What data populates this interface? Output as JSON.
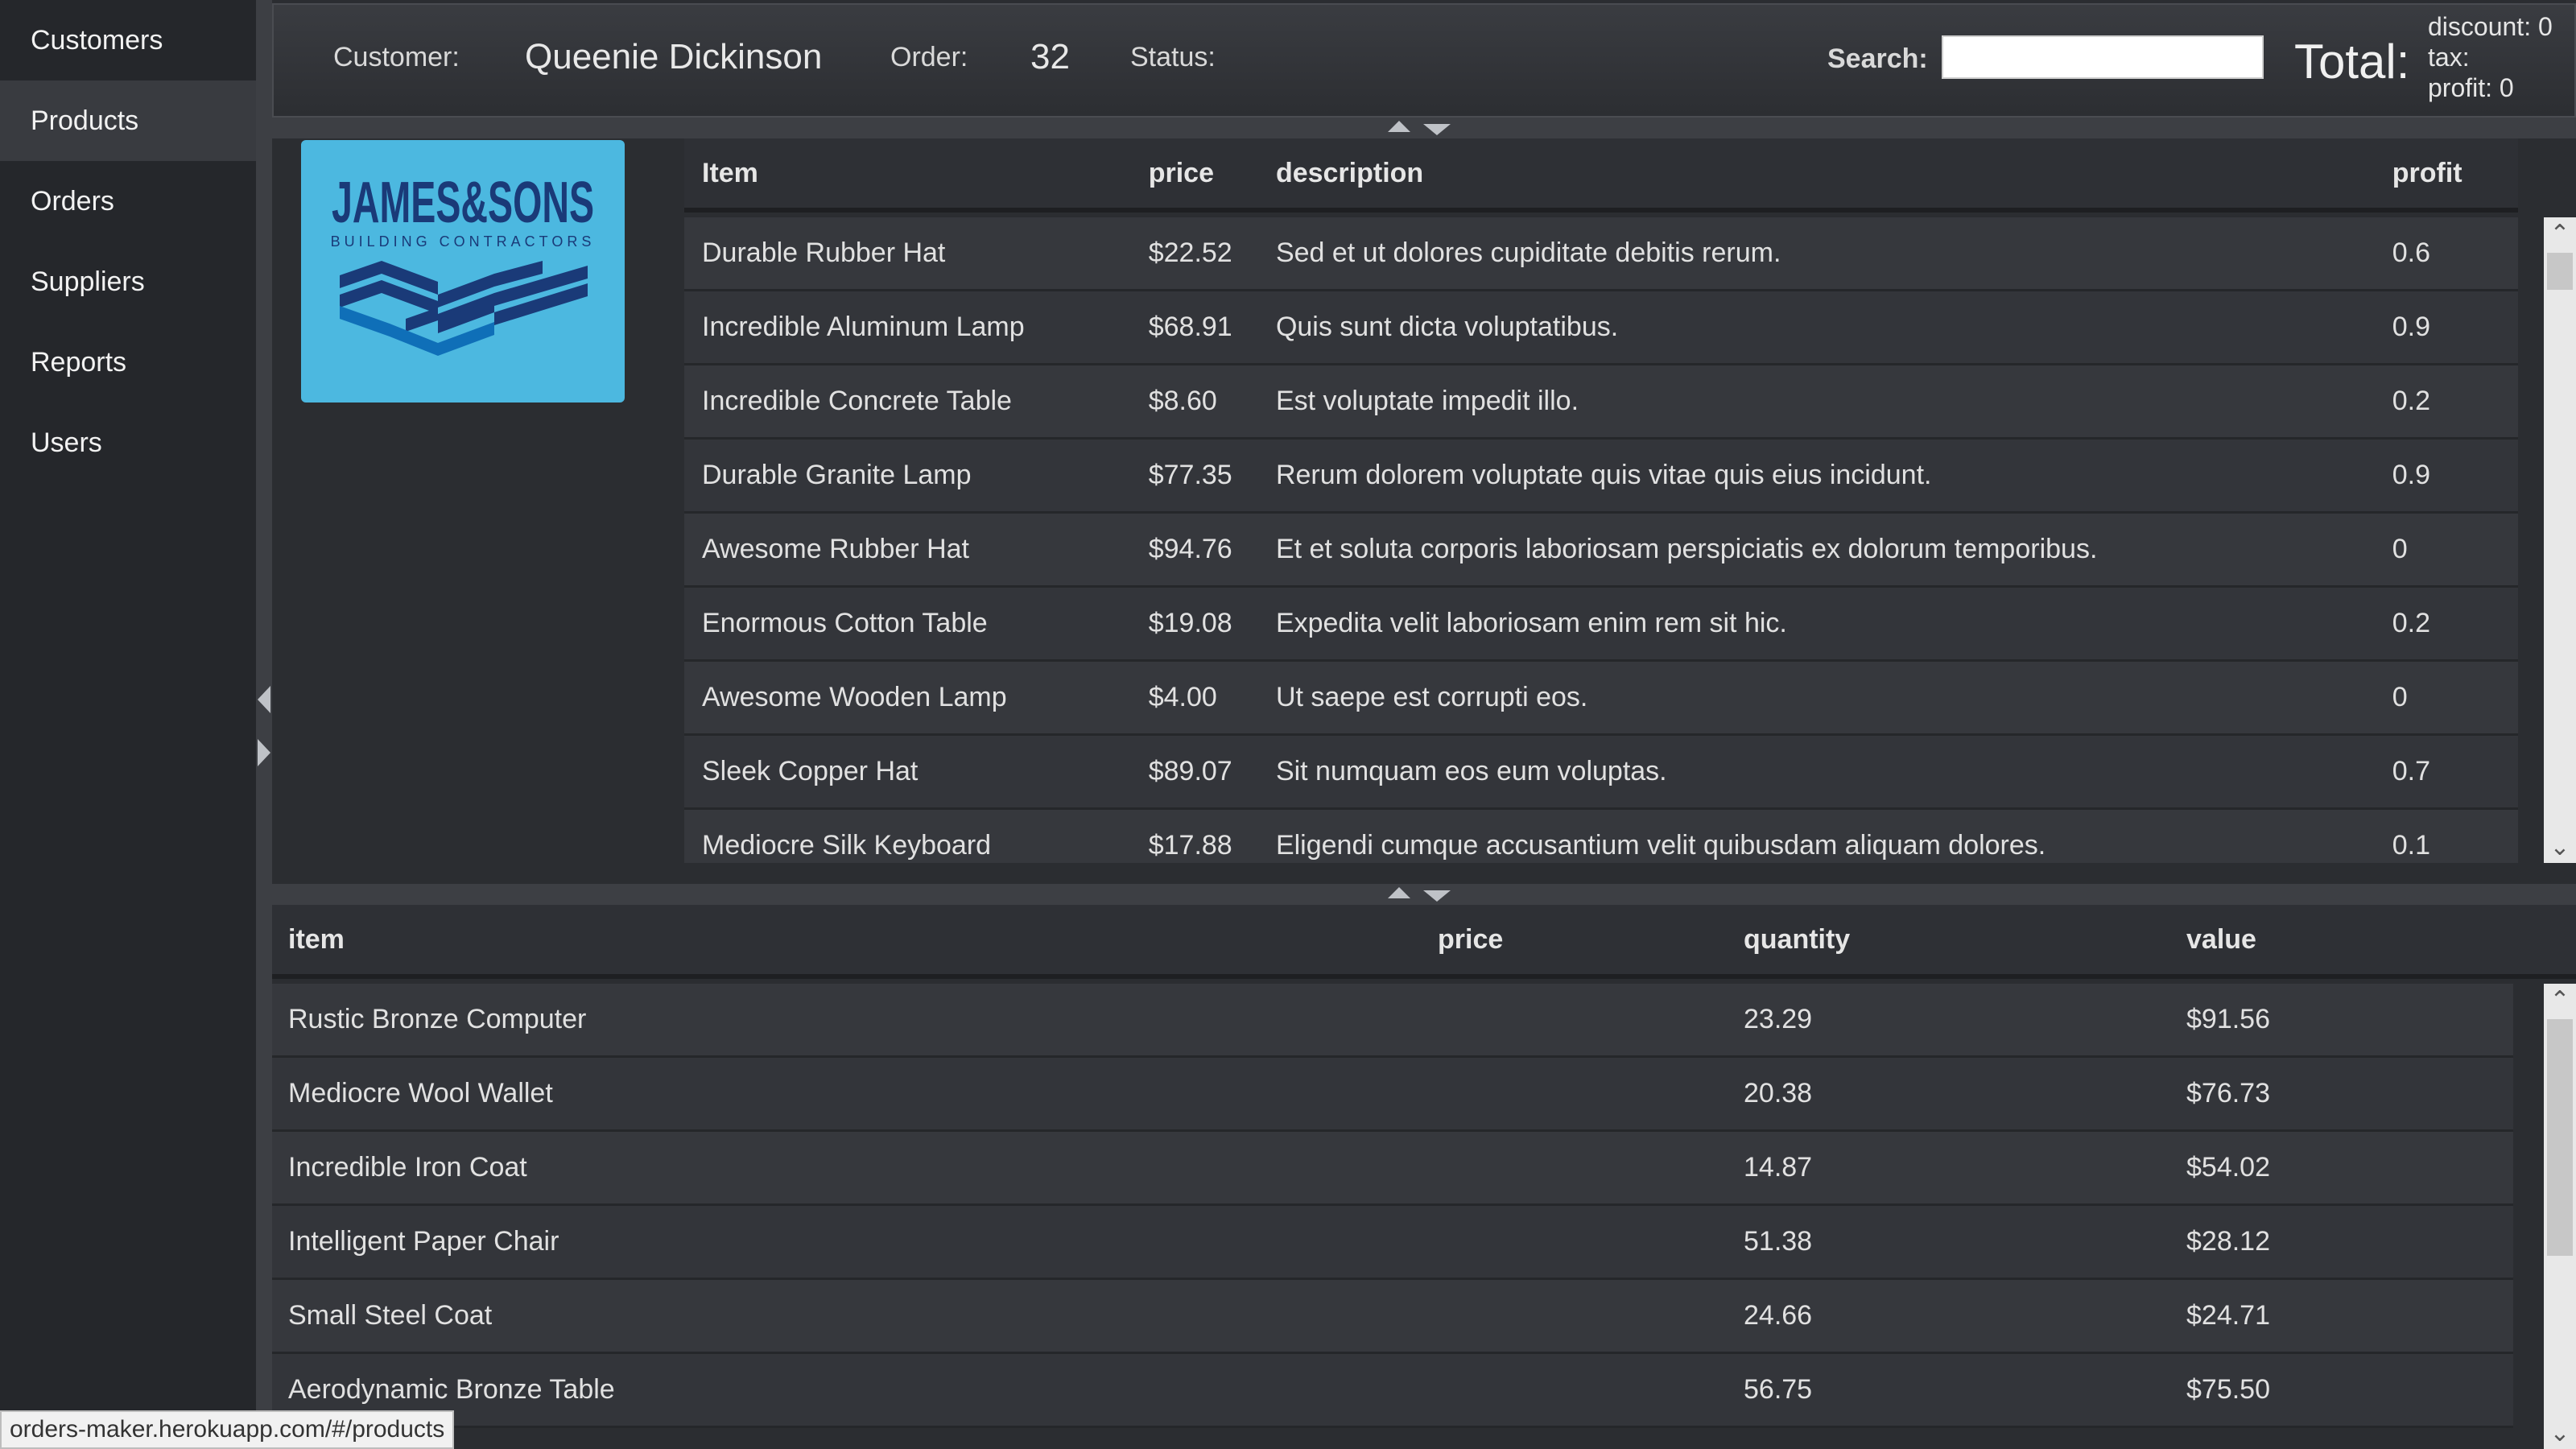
{
  "sidebar": {
    "items": [
      {
        "label": "Customers"
      },
      {
        "label": "Products"
      },
      {
        "label": "Orders"
      },
      {
        "label": "Suppliers"
      },
      {
        "label": "Reports"
      },
      {
        "label": "Users"
      }
    ],
    "active_index": 1
  },
  "header": {
    "customer_label": "Customer:",
    "customer_name": "Queenie Dickinson",
    "order_label": "Order:",
    "order_number": "32",
    "status_label": "Status:",
    "search_label": "Search:",
    "search_value": "",
    "total_label": "Total:",
    "discount_text": "discount: 0",
    "tax_text": "tax:",
    "profit_text": "profit: 0"
  },
  "logo": {
    "brand": "JAMES&SONS",
    "brand_main": "JAMES",
    "brand_amp": "&",
    "brand_end": "SONS",
    "tagline": "BUILDING CONTRACTORS",
    "bg_color": "#4cb8e0",
    "dark_color": "#1a3a78"
  },
  "products": {
    "columns": {
      "item": "Item",
      "price": "price",
      "description": "description",
      "profit": "profit"
    },
    "rows": [
      {
        "item": "Durable Rubber Hat",
        "price": "$22.52",
        "description": "Sed et ut dolores cupiditate debitis rerum.",
        "profit": "0.6"
      },
      {
        "item": "Incredible Aluminum Lamp",
        "price": "$68.91",
        "description": "Quis sunt dicta voluptatibus.",
        "profit": "0.9"
      },
      {
        "item": "Incredible Concrete Table",
        "price": "$8.60",
        "description": "Est voluptate impedit illo.",
        "profit": "0.2"
      },
      {
        "item": "Durable Granite Lamp",
        "price": "$77.35",
        "description": "Rerum dolorem voluptate quis vitae quis eius incidunt.",
        "profit": "0.9"
      },
      {
        "item": "Awesome Rubber Hat",
        "price": "$94.76",
        "description": "Et et soluta corporis laboriosam perspiciatis ex dolorum temporibus.",
        "profit": "0"
      },
      {
        "item": "Enormous Cotton Table",
        "price": "$19.08",
        "description": "Expedita velit laboriosam enim rem sit hic.",
        "profit": "0.2"
      },
      {
        "item": "Awesome Wooden Lamp",
        "price": "$4.00",
        "description": "Ut saepe est corrupti eos.",
        "profit": "0"
      },
      {
        "item": "Sleek Copper Hat",
        "price": "$89.07",
        "description": "Sit numquam eos eum voluptas.",
        "profit": "0.7"
      },
      {
        "item": "Mediocre Silk Keyboard",
        "price": "$17.88",
        "description": "Eligendi cumque accusantium velit quibusdam aliquam dolores.",
        "profit": "0.1"
      }
    ]
  },
  "order_items": {
    "columns": {
      "item": "item",
      "price": "price",
      "quantity": "quantity",
      "value": "value"
    },
    "rows": [
      {
        "item": "Rustic Bronze Computer",
        "price": "",
        "quantity": "23.29",
        "value": "$91.56"
      },
      {
        "item": "Mediocre Wool Wallet",
        "price": "",
        "quantity": "20.38",
        "value": "$76.73"
      },
      {
        "item": "Incredible Iron Coat",
        "price": "",
        "quantity": "14.87",
        "value": "$54.02"
      },
      {
        "item": "Intelligent Paper Chair",
        "price": "",
        "quantity": "51.38",
        "value": "$28.12"
      },
      {
        "item": "Small Steel Coat",
        "price": "",
        "quantity": "24.66",
        "value": "$24.71"
      },
      {
        "item": "Aerodynamic Bronze Table",
        "price": "",
        "quantity": "56.75",
        "value": "$75.50"
      }
    ]
  },
  "status_bar": {
    "url": "orders-maker.herokuapp.com/#/products"
  },
  "icons": {
    "scroll_up": "chevron-up-icon",
    "scroll_down": "chevron-down-icon",
    "collapse_left": "triangle-left-icon",
    "expand_right": "triangle-right-icon"
  }
}
